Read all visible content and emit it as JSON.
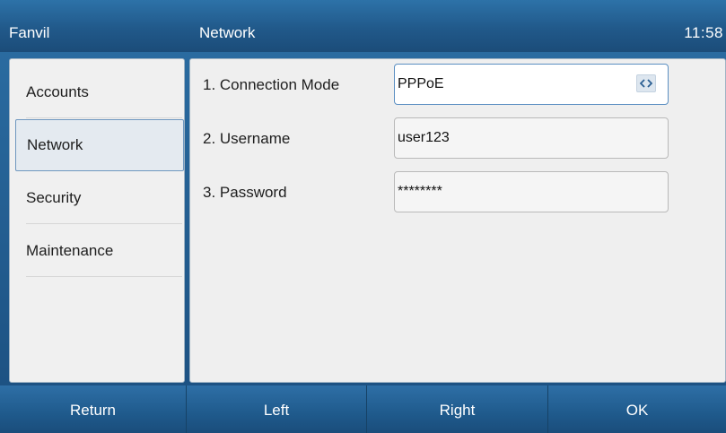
{
  "topbar": {
    "brand": "Fanvil",
    "title": "Network",
    "clock": "11:58"
  },
  "sidebar": {
    "items": [
      {
        "label": "Accounts"
      },
      {
        "label": "Network",
        "active": true
      },
      {
        "label": "Security"
      },
      {
        "label": "Maintenance"
      }
    ]
  },
  "form": {
    "rows": [
      {
        "label": "1. Connection Mode",
        "value": "PPPoE",
        "type": "select"
      },
      {
        "label": "2. Username",
        "value": "user123",
        "type": "text"
      },
      {
        "label": "3. Password",
        "value": "********",
        "type": "password"
      }
    ]
  },
  "softkeys": [
    "Return",
    "Left",
    "Right",
    "OK"
  ],
  "colors": {
    "accent": "#21598a",
    "panel": "#efefef",
    "active_item": "#e4eaf0"
  },
  "icons": {
    "selector": "left-right-arrows-icon"
  }
}
